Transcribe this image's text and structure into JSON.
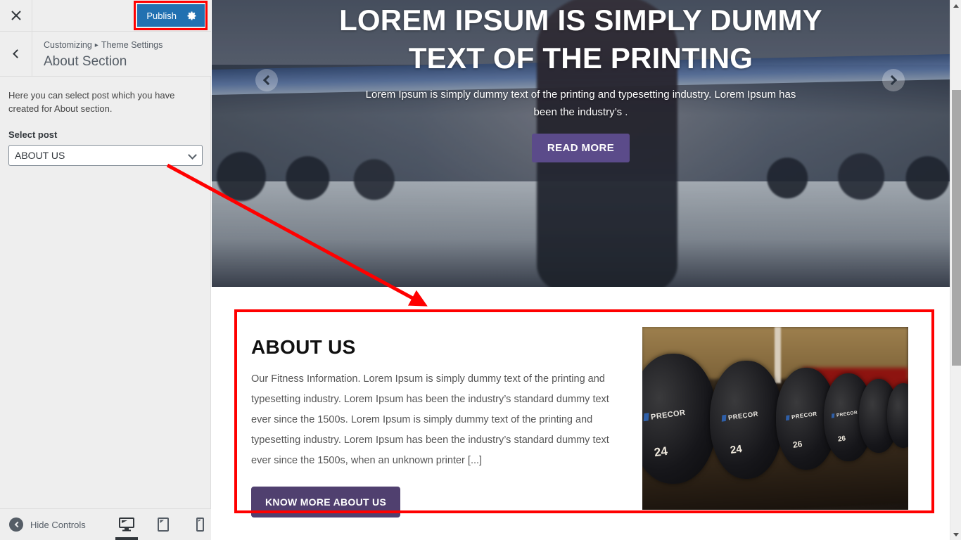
{
  "customizer": {
    "close_icon": "close-icon",
    "publish_label": "Publish",
    "publish_gear_icon": "gear-icon",
    "back_icon": "chevron-left-icon",
    "breadcrumb_root": "Customizing",
    "breadcrumb_separator": "▸",
    "breadcrumb_parent": "Theme Settings",
    "panel_title": "About Section",
    "help_text": "Here you can select post which you have created for About section.",
    "field_label": "Select post",
    "select_value": "ABOUT US",
    "select_arrow_icon": "chevron-down-icon",
    "footer": {
      "hide_controls_label": "Hide Controls",
      "hide_controls_icon": "collapse-arrow-icon",
      "devices": [
        {
          "name": "desktop-icon",
          "active": true
        },
        {
          "name": "tablet-icon",
          "active": false
        },
        {
          "name": "mobile-icon",
          "active": false
        }
      ]
    }
  },
  "preview": {
    "hero": {
      "title": "LOREM IPSUM IS SIMPLY DUMMY TEXT OF THE PRINTING",
      "subtitle": "Lorem Ipsum is simply dummy text of the printing and typesetting industry. Lorem Ipsum has been the industry’s .",
      "button_label": "READ MORE",
      "prev_icon": "chevron-left-circle-icon",
      "next_icon": "chevron-right-circle-icon"
    },
    "about": {
      "title": "ABOUT US",
      "text": "Our Fitness Information. Lorem Ipsum is simply dummy text of the printing and typesetting industry. Lorem Ipsum has been the industry’s standard dummy text ever since the 1500s. Lorem Ipsum is simply dummy text of the printing and typesetting industry. Lorem Ipsum has been the industry’s standard dummy text ever since the 1500s, when an unknown printer [...]",
      "button_label": "KNOW MORE ABOUT US",
      "image_alt": "dumbbell-rack-photo",
      "image_dumbbells": [
        {
          "brand": "PRECOR",
          "weight": "24"
        },
        {
          "brand": "PRECOR",
          "weight": "24"
        },
        {
          "brand": "PRECOR",
          "weight": "26"
        },
        {
          "brand": "PRECOR",
          "weight": "26"
        }
      ]
    },
    "scrollbar": {
      "up_icon": "scroll-up-arrow-icon",
      "down_icon": "scroll-down-arrow-icon"
    }
  },
  "annotations": {
    "accent_color": "#ff0000",
    "publish_highlight": "publish-button-highlight",
    "about_highlight": "about-section-highlight",
    "arrow": "select-post-to-about-section-arrow"
  },
  "colors": {
    "publish_blue": "#2271b1",
    "hero_button_purple": "#5b4b8a",
    "about_button_purple": "#50406f",
    "panel_bg": "#eeeeee",
    "annotation_red": "#ff0000"
  }
}
